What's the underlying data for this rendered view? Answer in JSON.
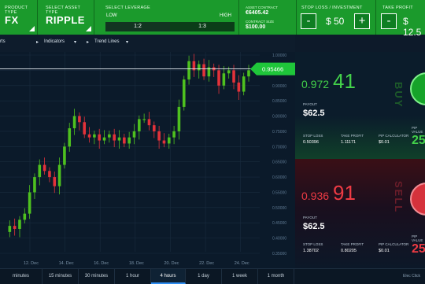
{
  "header": {
    "product": {
      "label": "PRODUCT TYPE",
      "value": "FX"
    },
    "asset": {
      "label": "SELECT ASSET TYPE",
      "value": "RIPPLE"
    },
    "leverage": {
      "label": "SELECT LEVERAGE",
      "low": "LOW",
      "high": "HIGH",
      "options": [
        "1:2",
        "1:3"
      ],
      "selected": "1:2"
    },
    "stats": [
      {
        "label": "ASSET CONTRACT",
        "value": "€6405.42"
      },
      {
        "label": "CONTRACT SIZE",
        "value": "$100.00"
      }
    ],
    "stoploss": {
      "label": "STOP LOSS / INVESTMENT",
      "minus": "-",
      "plus": "+",
      "value": "$ 50"
    },
    "takeprofit": {
      "label": "TAKE PROFIT",
      "minus": "-",
      "value": "$ 12.5"
    }
  },
  "toolbar": {
    "items": [
      "rts",
      "Indicators",
      "Trend Lines"
    ]
  },
  "chart_data": {
    "type": "candlestick",
    "x_ticks": [
      "12. Dec",
      "14. Dec",
      "16. Dec",
      "18. Dec",
      "20. Dec",
      "22. Dec",
      "24. Dec"
    ],
    "y_ticks": [
      "1.00000",
      "0.95000",
      "0.90000",
      "0.85000",
      "0.80000",
      "0.75000",
      "0.70000",
      "0.65000",
      "0.60000",
      "0.55000",
      "0.50000",
      "0.45000",
      "0.40000",
      "0.35000"
    ],
    "current_price": "0.95466",
    "series": [
      0.42,
      0.44,
      0.43,
      0.46,
      0.48,
      0.55,
      0.6,
      0.64,
      0.62,
      0.6,
      0.57,
      0.64,
      0.7,
      0.76,
      0.8,
      0.78,
      0.74,
      0.73,
      0.74,
      0.72,
      0.73,
      0.74,
      0.72,
      0.73,
      0.71,
      0.73,
      0.75,
      0.79,
      0.79,
      0.77,
      0.75,
      0.72,
      0.71,
      0.73,
      0.75,
      0.83,
      0.92,
      0.98,
      0.95,
      0.97,
      0.93,
      0.96,
      0.95,
      0.9,
      0.94,
      0.95,
      0.91,
      0.88,
      0.93,
      0.95
    ]
  },
  "timeframes": {
    "items": [
      "minutes",
      "15 minutes",
      "30 minutes",
      "1 hour",
      "4 hours",
      "1 day",
      "1 week",
      "1 month"
    ],
    "active": "4 hours"
  },
  "footnote": "Elec Click",
  "buy": {
    "price_small": "0.972",
    "price_big": "41",
    "payout_label": "PAYOUT",
    "payout": "$62.5",
    "stats": [
      {
        "label": "STOP LOSS",
        "value": "0.50396"
      },
      {
        "label": "TAKE PROFIT",
        "value": "1.11171"
      },
      {
        "label": "PIP CALCULATOR",
        "value": "$0.01"
      }
    ],
    "side_label": "BUY",
    "percent": "25",
    "percent_label": "PIP VALUE"
  },
  "sell": {
    "price_small": "0.936",
    "price_big": "91",
    "payout_label": "PAYOUT",
    "payout": "$62.5",
    "stats": [
      {
        "label": "STOP LOSS",
        "value": "1.38702"
      },
      {
        "label": "TAKE PROFIT",
        "value": "0.80205"
      },
      {
        "label": "PIP CALCULATOR",
        "value": "$0.01"
      }
    ],
    "side_label": "SELL",
    "percent": "25",
    "percent_label": "PIP VALUE"
  },
  "colors": {
    "green": "#1b9a2c",
    "red": "#d5323c",
    "bull": "#4ec11f",
    "bear": "#e3323a"
  }
}
